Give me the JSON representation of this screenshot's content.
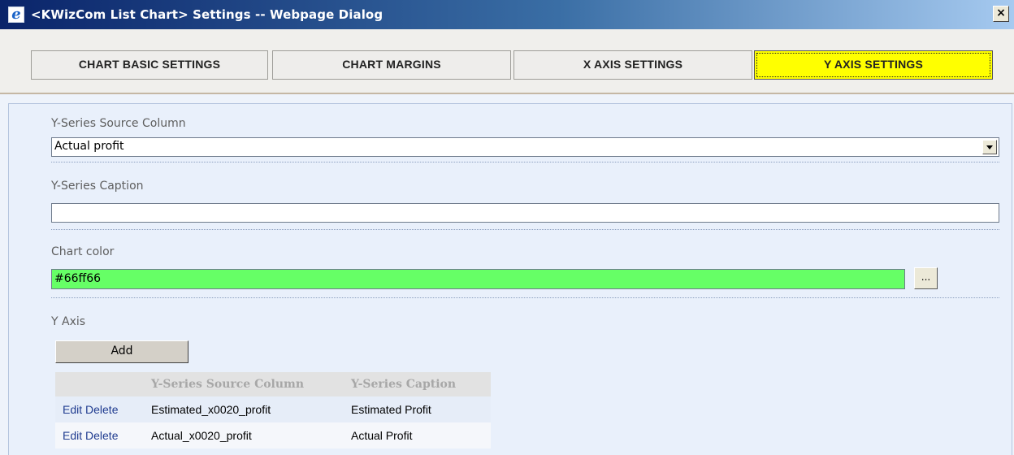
{
  "window": {
    "title": "<KWizCom List Chart> Settings -- Webpage Dialog",
    "close_glyph": "×",
    "icon": "ie-icon",
    "icon_glyph": "e"
  },
  "tabs": [
    {
      "label": "CHART BASIC SETTINGS",
      "active": false
    },
    {
      "label": "CHART MARGINS",
      "active": false
    },
    {
      "label": "X AXIS SETTINGS",
      "active": false
    },
    {
      "label": "Y AXIS SETTINGS",
      "active": true
    }
  ],
  "form": {
    "source_column": {
      "label": "Y-Series Source Column",
      "value": "Actual profit"
    },
    "caption": {
      "label": "Y-Series Caption",
      "value": ""
    },
    "chart_color": {
      "label": "Chart color",
      "value": "#66ff66",
      "picker_label": "..."
    },
    "y_axis": {
      "label": "Y Axis",
      "add_label": "Add",
      "table": {
        "headers": [
          "",
          "Y-Series Source Column",
          "Y-Series Caption"
        ],
        "rows": [
          {
            "edit": "Edit",
            "delete": "Delete",
            "source": "Estimated_x0020_profit",
            "caption": "Estimated Profit"
          },
          {
            "edit": "Edit",
            "delete": "Delete",
            "source": "Actual_x0020_profit",
            "caption": "Actual Profit"
          }
        ]
      }
    }
  },
  "colors": {
    "active_tab": "#ffff00",
    "chart_color_swatch": "#66ff66",
    "panel_background": "#e9f0fb",
    "title_bar": "#0a246a"
  }
}
